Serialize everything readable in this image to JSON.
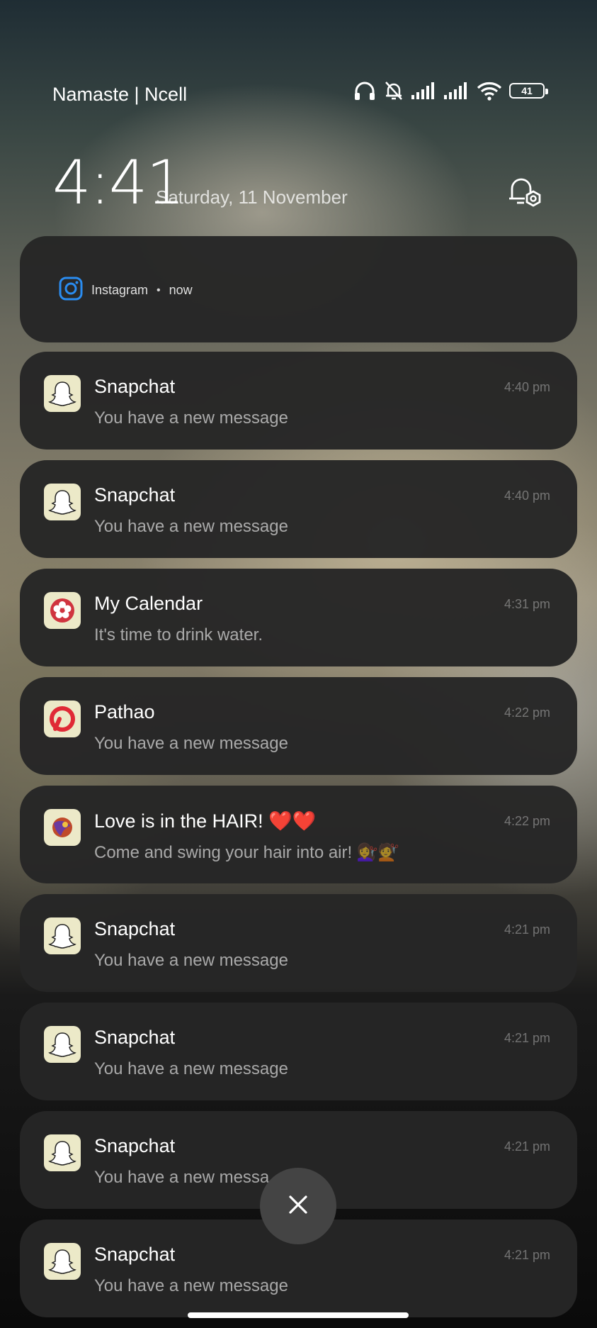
{
  "status_bar": {
    "carrier": "Namaste | Ncell",
    "battery_level": "41",
    "icons": [
      "headphones-icon",
      "bell-muted-icon",
      "signal-icon",
      "signal-icon",
      "wifi-icon",
      "battery-icon"
    ]
  },
  "lockscreen": {
    "time": "4:41",
    "date": "Saturday, 11 November"
  },
  "instagram_notification": {
    "app": "Instagram",
    "separator": "•",
    "time": "now"
  },
  "notifications": [
    {
      "app": "snapchat",
      "title": "Snapchat",
      "body": "You have a new message",
      "time": "4:40 pm"
    },
    {
      "app": "snapchat",
      "title": "Snapchat",
      "body": "You have a new message",
      "time": "4:40 pm"
    },
    {
      "app": "calendar",
      "title": "My Calendar",
      "body": "It's time to drink water.",
      "time": "4:31 pm"
    },
    {
      "app": "pathao",
      "title": "Pathao",
      "body": "You have a new message",
      "time": "4:22 pm"
    },
    {
      "app": "salon",
      "title": "Love is in the HAIR! ❤️❤️",
      "body": "Come and swing your hair into air! 💇‍♀️💇",
      "time": "4:22 pm"
    },
    {
      "app": "snapchat",
      "title": "Snapchat",
      "body": "You have a new message",
      "time": "4:21 pm"
    },
    {
      "app": "snapchat",
      "title": "Snapchat",
      "body": "You have a new message",
      "time": "4:21 pm"
    },
    {
      "app": "snapchat",
      "title": "Snapchat",
      "body": "You have a new messa",
      "time": "4:21 pm"
    },
    {
      "app": "snapchat",
      "title": "Snapchat",
      "body": "You have a new message",
      "time": "4:21 pm"
    }
  ]
}
